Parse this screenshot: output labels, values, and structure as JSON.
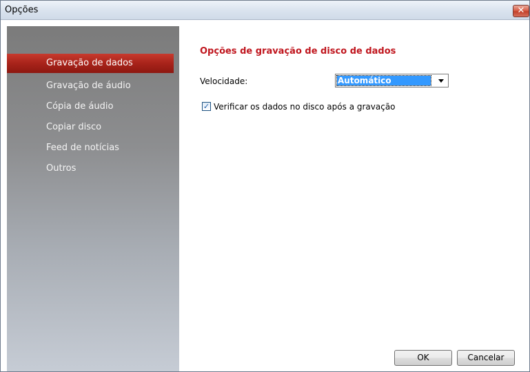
{
  "window": {
    "title": "Opções",
    "close_glyph": "✕"
  },
  "sidebar": {
    "items": [
      {
        "label": "Gravação de dados",
        "active": true
      },
      {
        "label": "Gravação de áudio",
        "active": false
      },
      {
        "label": "Cópia de áudio",
        "active": false
      },
      {
        "label": "Copiar disco",
        "active": false
      },
      {
        "label": "Feed de notícias",
        "active": false
      },
      {
        "label": "Outros",
        "active": false
      }
    ]
  },
  "content": {
    "section_title": "Opções de gravação de disco de dados",
    "speed_label": "Velocidade:",
    "speed_value": "Automático",
    "verify_label": "Verificar os dados no disco após a gravação",
    "verify_checked": true,
    "check_glyph": "✓"
  },
  "buttons": {
    "ok_label": "OK",
    "cancel_label": "Cancelar"
  },
  "colors": {
    "accent": "#c0161e",
    "selection": "#3399ff",
    "active_nav": "#a8231a"
  },
  "icons": {
    "close": "close-icon",
    "dropdown": "chevron-down-icon",
    "check": "checkmark-icon"
  }
}
